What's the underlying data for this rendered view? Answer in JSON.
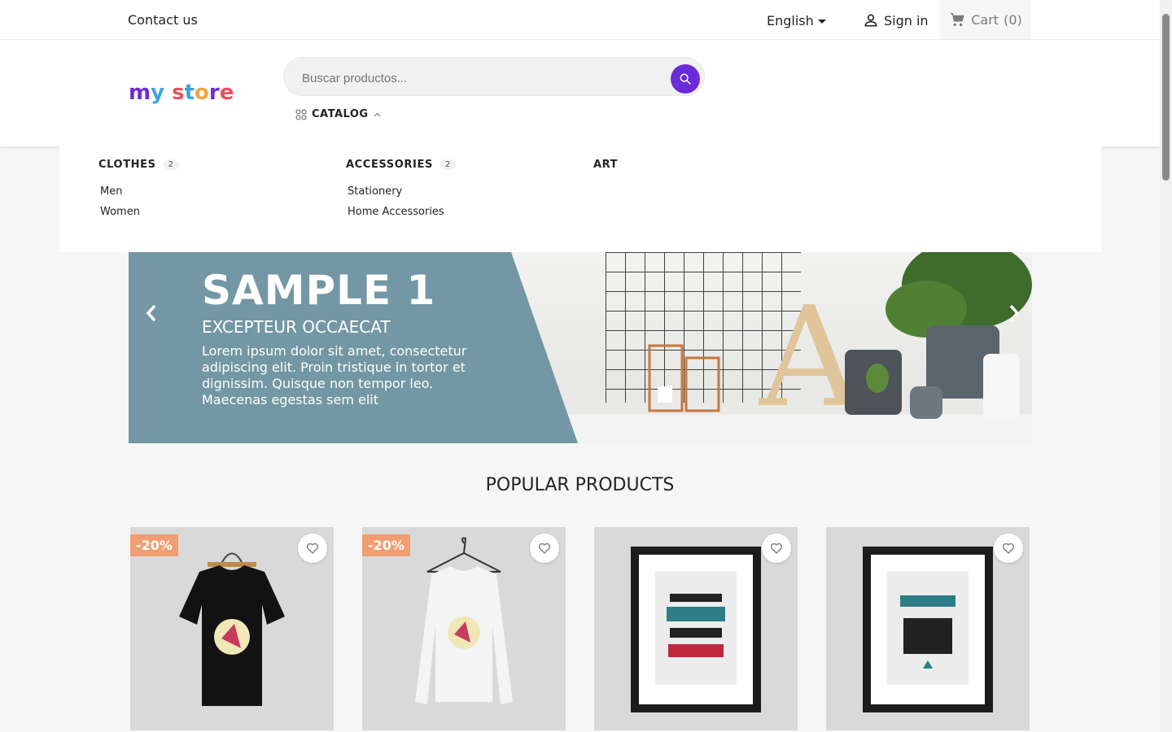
{
  "topbar": {
    "contact_label": "Contact us",
    "language": "English",
    "signin_label": "Sign in",
    "cart_label": "Cart",
    "cart_count": "(0)"
  },
  "header": {
    "logo_text": "my store",
    "search_placeholder": "Buscar productos...",
    "catalog_label": "CATALOG"
  },
  "megamenu": {
    "columns": [
      {
        "title": "CLOTHES",
        "count": "2",
        "items": [
          "Men",
          "Women"
        ]
      },
      {
        "title": "ACCESSORIES",
        "count": "2",
        "items": [
          "Stationery",
          "Home Accessories"
        ]
      },
      {
        "title": "ART",
        "count": "",
        "items": []
      }
    ]
  },
  "slider": {
    "title": "SAMPLE 1",
    "subtitle": "EXCEPTEUR OCCAECAT",
    "text": "Lorem ipsum dolor sit amet, consectetur adipiscing elit. Proin tristique in tortor et dignissim. Quisque non tempor leo. Maecenas egestas sem elit"
  },
  "popular": {
    "title": "POPULAR PRODUCTS",
    "products": [
      {
        "flag": "-20%"
      },
      {
        "flag": "-20%"
      },
      {
        "flag": ""
      },
      {
        "flag": ""
      }
    ]
  },
  "colors": {
    "accent": "#6c2bd9",
    "discount_flag": "#f39d72",
    "slide_panel": "#7397a4"
  },
  "icons": {
    "user": "user-icon",
    "cart": "cart-icon",
    "search": "search-icon",
    "catalog": "grid-icon",
    "heart": "heart-icon",
    "prev": "chevron-left-icon",
    "next": "chevron-right-icon"
  }
}
